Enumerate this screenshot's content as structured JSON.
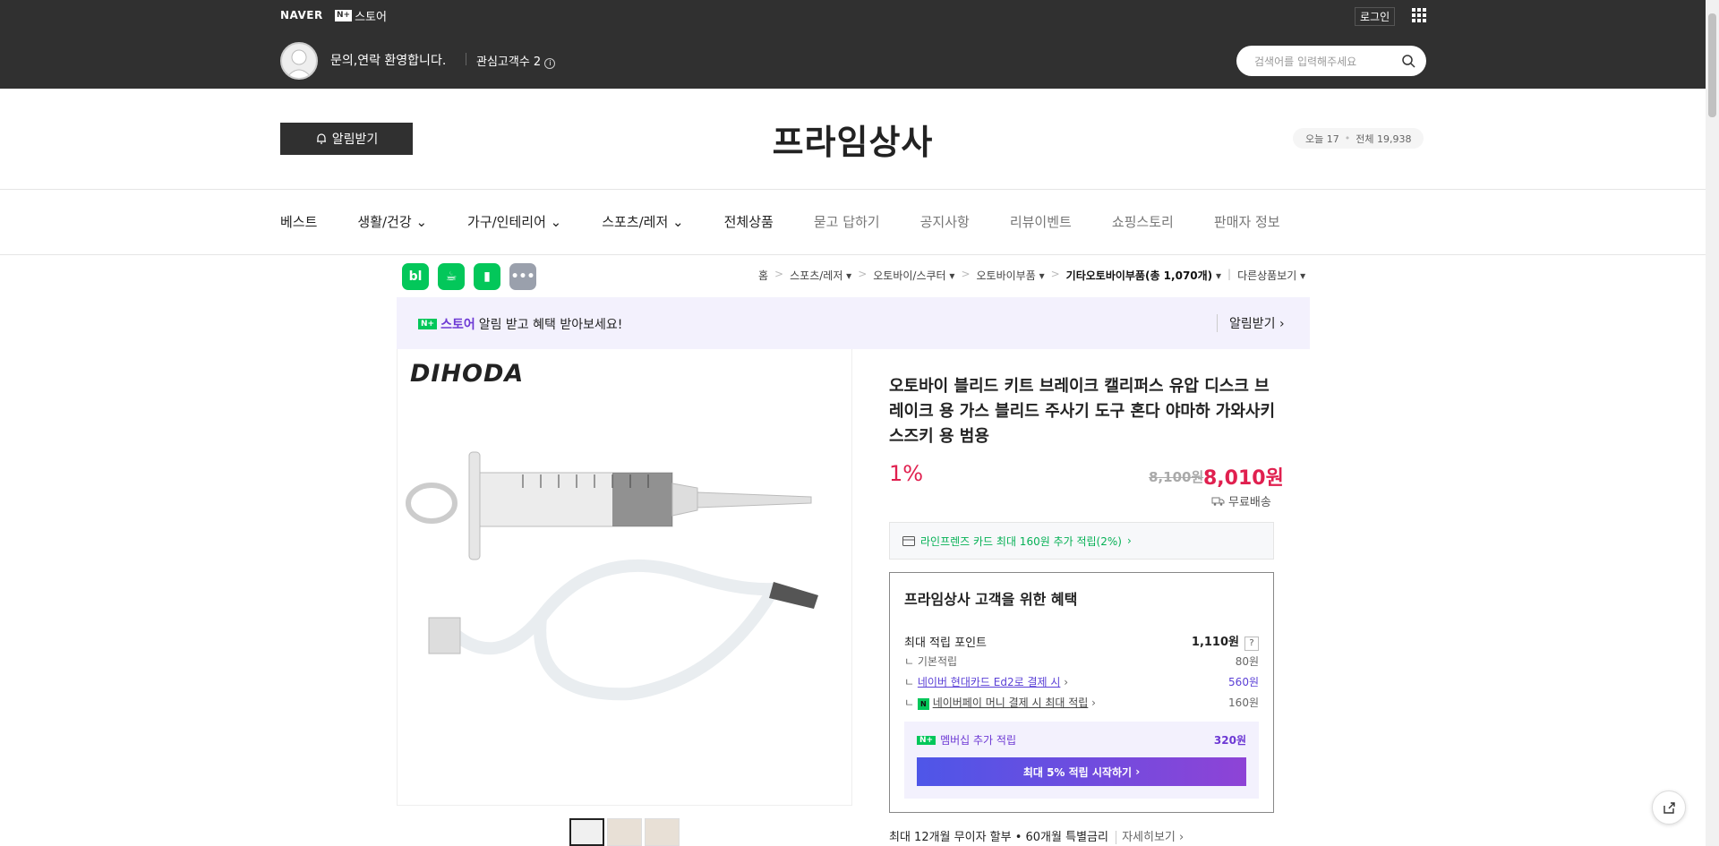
{
  "header": {
    "brand": "NAVER",
    "store_badge": "N+",
    "store_label": "스토어",
    "login": "로그인",
    "welcome": "문의,연락 환영합니다.",
    "interest": "관심고객수 2",
    "search_placeholder": "검색어를 입력해주세요"
  },
  "shop": {
    "title": "프라임상사",
    "alarm_button": "알림받기",
    "visit_today": "오늘 17",
    "visit_total": "전체 19,938"
  },
  "nav": {
    "items": [
      "베스트",
      "생활/건강",
      "가구/인테리어",
      "스포츠/레저",
      "전체상품",
      "묻고 답하기",
      "공지사항",
      "리뷰이벤트",
      "쇼핑스토리",
      "판매자 정보"
    ]
  },
  "breadcrumb": {
    "items": [
      "홈",
      "스포츠/레저",
      "오토바이/스쿠터",
      "오토바이부품",
      "기타오토바이부품",
      "(총 1,070개)",
      "다른상품보기"
    ]
  },
  "banner": {
    "store": "스토어",
    "text": "알림 받고 혜택 받아보세요!",
    "button": "알림받기"
  },
  "product": {
    "brand_logo": "DIHODA",
    "title": "오토바이 블리드 키트 브레이크 캘리퍼스 유압 디스크 브레이크 용 가스 블리드 주사기 도구 혼다 야마하 가와사키 스즈키 용 범용",
    "discount": "1%",
    "original_price": "8,100원",
    "price": "8,010원",
    "shipping": "무료배송",
    "card_benefit": "라인프렌즈 카드 최대 160원 추가 적립(2%)",
    "installment": "최대 12개월 무이자 할부 • 60개월 특별금리",
    "installment_more": "자세히보기"
  },
  "benefit": {
    "title": "프라임상사 고객을 위한 혜택",
    "max_point_label": "최대 적립 포인트",
    "max_point_value": "1,110원",
    "help": "?",
    "rows": [
      {
        "label": "기본적립",
        "value": "80원"
      },
      {
        "label": "네이버 현대카드 Ed2로 결제 시",
        "value": "560원"
      },
      {
        "label": "네이버페이 머니 결제 시 최대 적립",
        "value": "160원"
      }
    ],
    "member_label": "멤버십 추가 적립",
    "member_value": "320원",
    "member_button": "최대 5% 적립 시작하기"
  },
  "colors": {
    "accent_red": "#e0204f",
    "accent_purple": "#6d39d4",
    "naver_green": "#03c75a"
  }
}
